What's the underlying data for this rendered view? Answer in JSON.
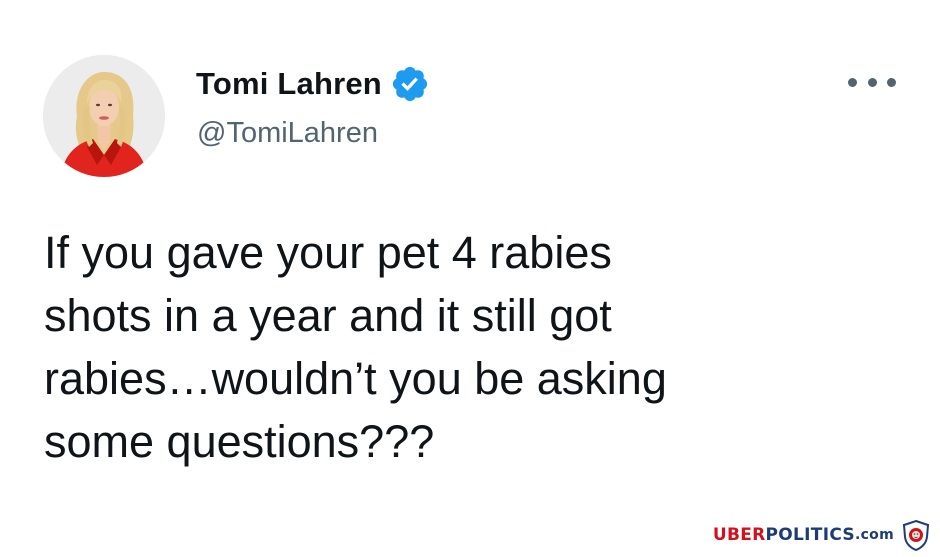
{
  "tweet": {
    "author": {
      "display_name": "Tomi Lahren",
      "handle": "@TomiLahren",
      "verified": true,
      "verified_icon": "verified-badge-icon",
      "avatar": "profile-photo"
    },
    "more_icon": "more-options-icon",
    "text_lines": [
      "If you gave your pet 4 rabies",
      "shots in a year and it still got",
      "rabies…wouldn’t you be asking",
      "some questions???"
    ]
  },
  "watermark": {
    "part1": "UBER",
    "part2": "POLITICS",
    "part3": ".com",
    "logo": "lion-crest-logo"
  },
  "colors": {
    "text": "#0f1419",
    "secondary": "#536471",
    "verified_blue": "#1d9bf0",
    "watermark_red": "#d4101e",
    "watermark_blue": "#1d3b78"
  }
}
